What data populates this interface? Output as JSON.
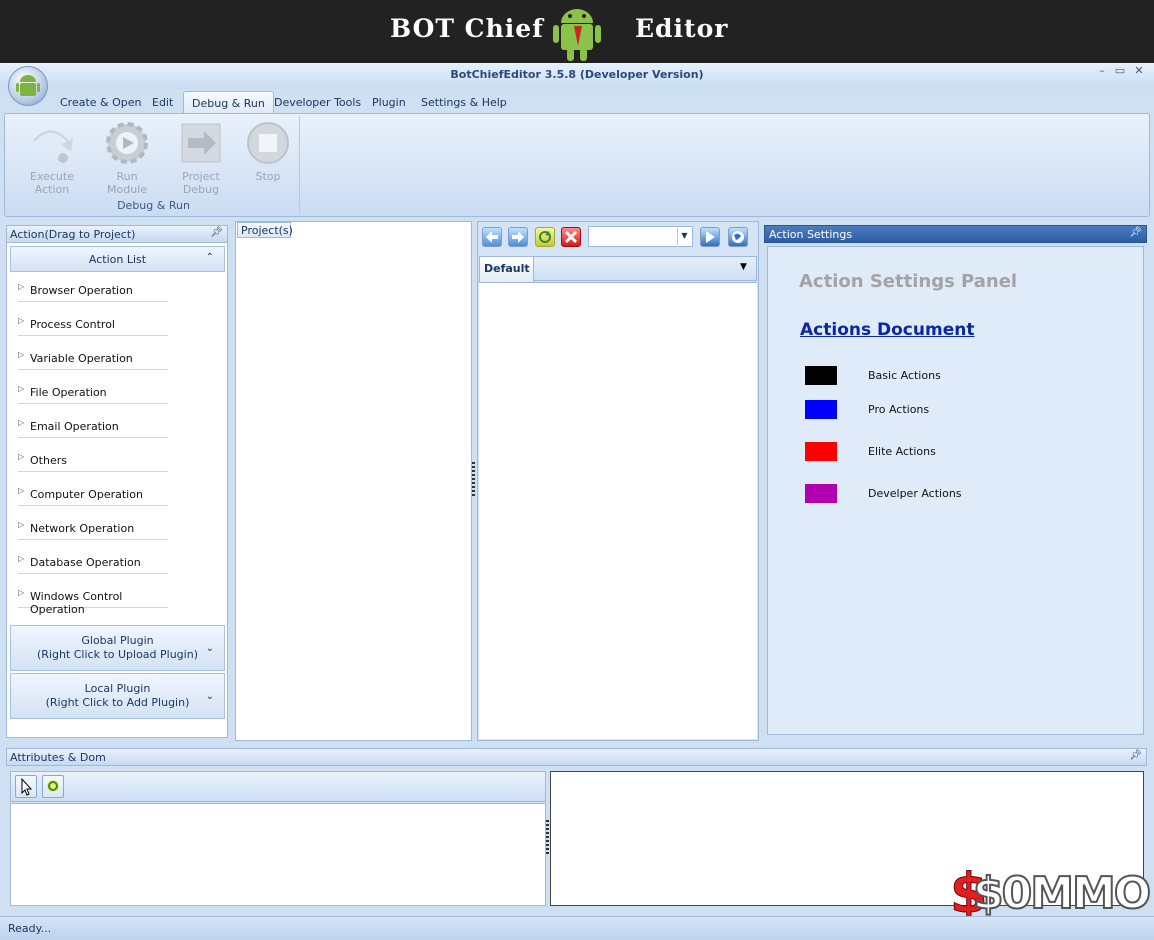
{
  "banner": {
    "left_text": "BOT Chief",
    "right_text": "Editor"
  },
  "window": {
    "title": "BotChiefEditor 3.5.8 (Developer Version)"
  },
  "ribbon": {
    "tabs": [
      "Create & Open",
      "Edit",
      "Debug & Run",
      "Developer Tools",
      "Plugin",
      "Settings & Help"
    ],
    "active_tab": "Debug & Run",
    "group_label": "Debug & Run",
    "buttons": [
      "Execute Action",
      "Run Module",
      "Project Debug",
      "Stop"
    ]
  },
  "left_panel": {
    "title": "Action(Drag to Project)",
    "action_list_header": "Action List",
    "categories": [
      "Browser Operation",
      "Process Control",
      "Variable Operation",
      "File Operation",
      "Email Operation",
      "Others",
      "Computer Operation",
      "Network Operation",
      "Database Operation",
      "Windows Control Operation"
    ],
    "global_plugin": {
      "line1": "Global Plugin",
      "line2": "(Right Click to Upload Plugin)"
    },
    "local_plugin": {
      "line1": "Local Plugin",
      "line2": "(Right Click to Add Plugin)"
    }
  },
  "projects": {
    "tab_label": "Project(s)"
  },
  "editor": {
    "tab_label": "Default",
    "combo_value": ""
  },
  "action_settings": {
    "header": "Action Settings",
    "panel_title": "Action Settings Panel",
    "doc_link": "Actions Document",
    "legend": [
      {
        "label": "Basic Actions",
        "color": "#000000"
      },
      {
        "label": "Pro Actions",
        "color": "#0000ff"
      },
      {
        "label": "Elite Actions",
        "color": "#ff0000"
      },
      {
        "label": "Develper Actions",
        "color": "#b000b0"
      }
    ]
  },
  "attributes": {
    "header": "Attributes & Dom"
  },
  "status": {
    "text": "Ready..."
  },
  "watermark": {
    "text": "$0MMO"
  },
  "colors": {
    "ribbon_bg": "#dce8f7",
    "settings_header": "#2d5ea5",
    "link": "#0a27a8"
  }
}
